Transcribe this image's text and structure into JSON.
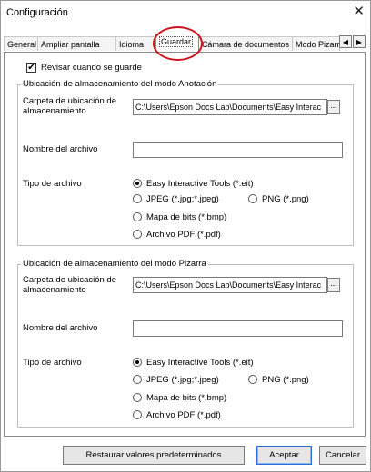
{
  "window": {
    "title": "Configuración",
    "close_glyph": "✕"
  },
  "tabs": [
    {
      "label": "General"
    },
    {
      "label": "Ampliar pantalla"
    },
    {
      "label": "Idioma"
    },
    {
      "label": "Guardar"
    },
    {
      "label": "Cámara de documentos"
    },
    {
      "label": "Modo Pizarra"
    }
  ],
  "tab_scroll": {
    "left": "◀",
    "right": "▶"
  },
  "review": {
    "label": "Revisar cuando se guarde",
    "checked": true,
    "check_glyph": "✔"
  },
  "annotation": {
    "legend": "Ubicación de almacenamiento del modo Anotación",
    "folder_label_1": "Carpeta de ubicación de",
    "folder_label_2": "almacenamiento",
    "folder_value": "C:\\Users\\Epson Docs Lab\\Documents\\Easy Interac",
    "browse": "...",
    "filename_label": "Nombre del archivo",
    "filename_value": "",
    "filetype_label": "Tipo de archivo",
    "options": {
      "eit": "Easy Interactive Tools (*.eit)",
      "jpeg": "JPEG (*.jpg;*.jpeg)",
      "png": "PNG (*.png)",
      "bmp": "Mapa de bits (*.bmp)",
      "pdf": "Archivo PDF (*.pdf)"
    },
    "selected": "eit"
  },
  "whiteboard": {
    "legend": "Ubicación de almacenamiento del modo Pizarra",
    "folder_label_1": "Carpeta de ubicación de",
    "folder_label_2": "almacenamiento",
    "folder_value": "C:\\Users\\Epson Docs Lab\\Documents\\Easy Interac",
    "browse": "...",
    "filename_label": "Nombre del archivo",
    "filename_value": "",
    "filetype_label": "Tipo de archivo",
    "options": {
      "eit": "Easy Interactive Tools (*.eit)",
      "jpeg": "JPEG (*.jpg;*.jpeg)",
      "png": "PNG (*.png)",
      "bmp": "Mapa de bits (*.bmp)",
      "pdf": "Archivo PDF (*.pdf)"
    },
    "selected": "eit"
  },
  "buttons": {
    "restore": "Restaurar valores predeterminados",
    "accept": "Aceptar",
    "cancel": "Cancelar"
  },
  "colors": {
    "highlight_circle": "#d0121b",
    "default_button_border": "#2b6fd6"
  }
}
